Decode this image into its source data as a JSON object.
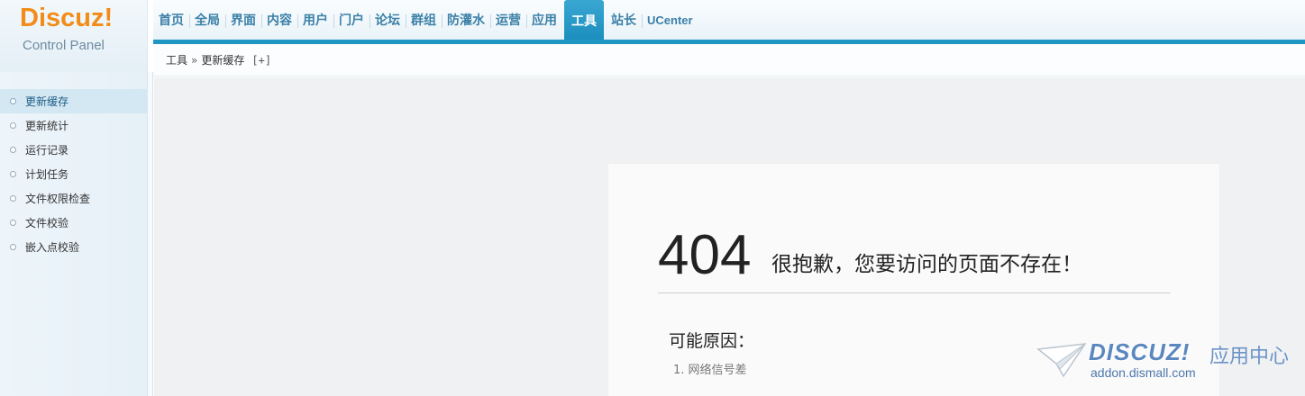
{
  "logo": {
    "brand": "Discuz!",
    "subtitle": "Control Panel"
  },
  "topnav": {
    "items": [
      {
        "label": "首页"
      },
      {
        "label": "全局"
      },
      {
        "label": "界面"
      },
      {
        "label": "内容"
      },
      {
        "label": "用户"
      },
      {
        "label": "门户"
      },
      {
        "label": "论坛"
      },
      {
        "label": "群组"
      },
      {
        "label": "防灌水"
      },
      {
        "label": "运营"
      },
      {
        "label": "应用"
      },
      {
        "label": "工具"
      },
      {
        "label": "站长"
      },
      {
        "label": "UCenter"
      }
    ],
    "active_index": 11
  },
  "breadcrumb": {
    "root": "工具",
    "separator": "»",
    "current": "更新缓存",
    "add": "[+]"
  },
  "sidebar": {
    "items": [
      {
        "label": "更新缓存"
      },
      {
        "label": "更新统计"
      },
      {
        "label": "运行记录"
      },
      {
        "label": "计划任务"
      },
      {
        "label": "文件权限检查"
      },
      {
        "label": "文件校验"
      },
      {
        "label": "嵌入点校验"
      }
    ],
    "active_index": 0
  },
  "error": {
    "code": "404",
    "message": "很抱歉，您要访问的页面不存在！",
    "reasons_title": "可能原因：",
    "reasons": [
      "1. 网络信号差"
    ]
  },
  "watermark": {
    "brand": "DISCUZ!",
    "cn": "应用中心",
    "url": "addon.dismall.com"
  },
  "colors": {
    "accent": "#1f96c3",
    "nav_text": "#3b80a8",
    "logo_orange": "#f28c18",
    "main_bg": "#f0f1f2"
  }
}
